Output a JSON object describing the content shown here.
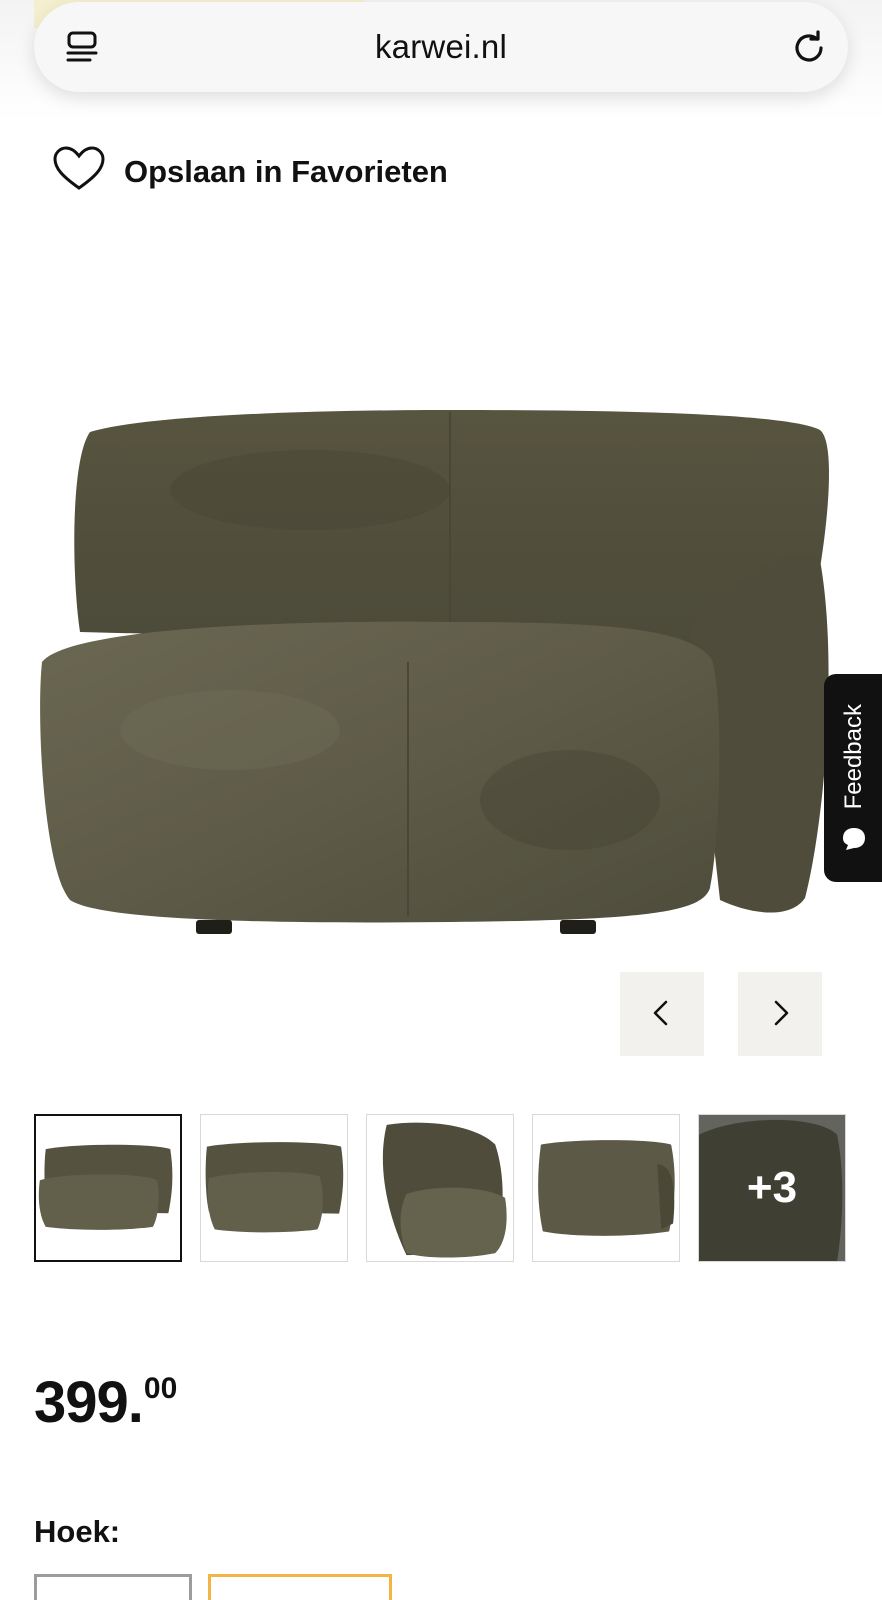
{
  "browser": {
    "url": "karwei.nl",
    "left_icon": "tabs-icon",
    "right_icon": "reload-icon"
  },
  "favorites": {
    "label": "Opslaan in Favorieten",
    "icon": "heart-icon"
  },
  "feedback": {
    "label": "Feedback"
  },
  "thumbnails": {
    "more_label": "+3"
  },
  "price": {
    "integer": "399",
    "dot": ".",
    "decimals": "00"
  },
  "variant": {
    "label": "Hoek:"
  },
  "colors": {
    "sofa": "#5b5847",
    "accent_option": "#f2b544",
    "arrow_bg": "#f2f1ee",
    "feedback_bg": "#111111"
  }
}
